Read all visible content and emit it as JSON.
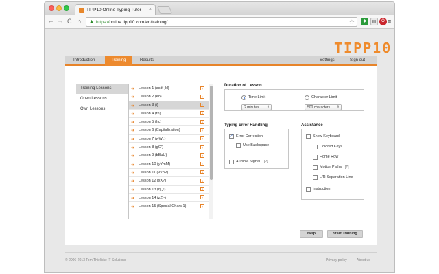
{
  "browser": {
    "tab_title": "TIPP10 Online Typing Tutor",
    "tab_close": "×",
    "url_scheme": "https://",
    "url_rest": "online.tipp10.com/en/training/",
    "back": "←",
    "forward": "→",
    "reload": "C",
    "home": "⌂",
    "lock": "🔒",
    "star": "☆",
    "menu": "≡"
  },
  "page": {
    "logo": "TIPP10",
    "nav": {
      "introduction": "Introduction",
      "training": "Training",
      "results": "Results",
      "settings": "Settings",
      "sign_out": "Sign out"
    },
    "left_menu": [
      "Training Lessons",
      "Open Lessons",
      "Own Lessons"
    ],
    "lessons": [
      "Lesson 1 (asdf jkl)",
      "Lesson 2 (eo)",
      "Lesson 3 (i)",
      "Lesson 4 (rn)",
      "Lesson 5 (hc)",
      "Lesson 6 (Capitalization)",
      "Lesson 7 (wW,.)",
      "Lesson 8 (gG')",
      "Lesson 9 (bBuU)",
      "Lesson 10 (yYmM)",
      "Lesson 11 (vVpP)",
      "Lesson 12 (xX?)",
      "Lesson 13 (qQ!)",
      "Lesson 14 (zZ|-)",
      "Lesson 15 (Special Chars 1)"
    ],
    "selected_lesson_index": 2,
    "lesson_arrow": "➔",
    "lesson_help": "?",
    "duration": {
      "title": "Duration of Lesson",
      "time_limit": "Time Limit",
      "character_limit": "Character Limit",
      "time_value": "2 minutes",
      "char_value": "500 characters",
      "selected": "time_limit"
    },
    "error_handling": {
      "title": "Typing Error Handling",
      "error_correction": "Error Correction",
      "use_backspace": "Use Backspace",
      "audible_signal": "Audible Signal",
      "help": "[?]"
    },
    "assistance": {
      "title": "Assistance",
      "show_keyboard": "Show Keyboard",
      "colored_keys": "Colored Keys",
      "home_row": "Home Row",
      "motion_paths": "Motion Paths",
      "motion_help": "[?]",
      "lr_separation": "L/R Separation Line",
      "instruction": "Instruction"
    },
    "buttons": {
      "help": "Help",
      "start_training": "Start Training"
    },
    "footer": {
      "copyright": "© 2006-2013 Tom Thielicke IT Solutions",
      "privacy": "Privacy policy",
      "about": "About us"
    }
  },
  "colors": {
    "accent": "#ed8a2e",
    "nav_bg": "#d4d4d4"
  }
}
